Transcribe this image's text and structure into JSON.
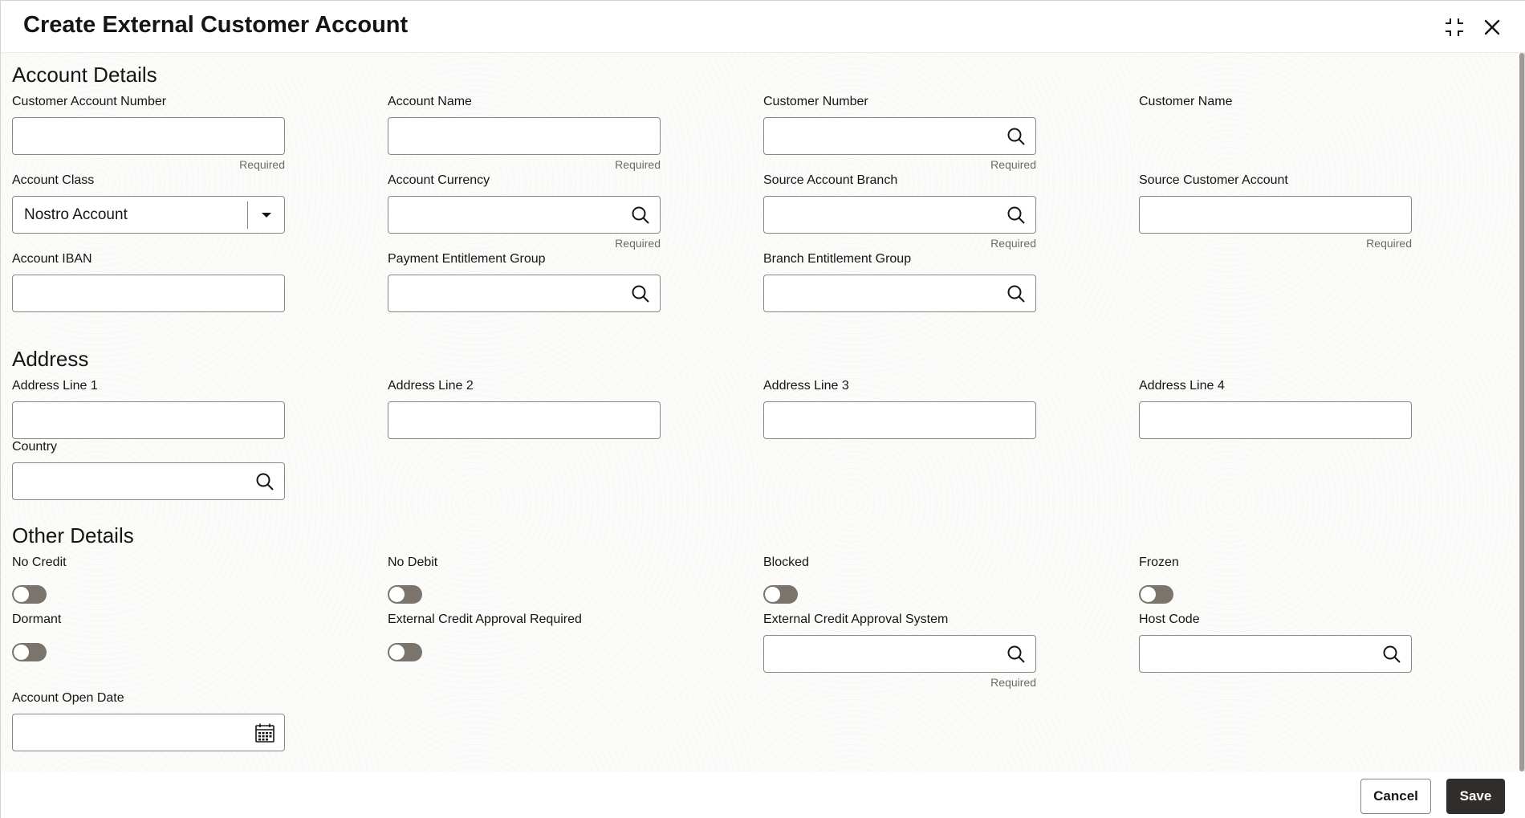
{
  "dialog": {
    "title": "Create External Customer Account",
    "icons": {
      "minimize": "compress-icon",
      "close": "close-icon"
    }
  },
  "sections": {
    "account_details": {
      "title": "Account Details",
      "customer_account_number": {
        "label": "Customer Account Number",
        "value": "",
        "hint": "Required"
      },
      "account_name": {
        "label": "Account Name",
        "value": "",
        "hint": "Required"
      },
      "customer_number": {
        "label": "Customer Number",
        "value": "",
        "hint": "Required"
      },
      "customer_name": {
        "label": "Customer Name"
      },
      "account_class": {
        "label": "Account Class",
        "value": "Nostro Account"
      },
      "account_currency": {
        "label": "Account Currency",
        "value": "",
        "hint": "Required"
      },
      "source_account_branch": {
        "label": "Source Account Branch",
        "value": "",
        "hint": "Required"
      },
      "source_customer_account": {
        "label": "Source Customer Account",
        "value": "",
        "hint": "Required"
      },
      "account_iban": {
        "label": "Account IBAN",
        "value": ""
      },
      "payment_entitlement_group": {
        "label": "Payment Entitlement Group",
        "value": ""
      },
      "branch_entitlement_group": {
        "label": "Branch Entitlement Group",
        "value": ""
      }
    },
    "address": {
      "title": "Address",
      "line1": {
        "label": "Address Line 1",
        "value": ""
      },
      "line2": {
        "label": "Address Line 2",
        "value": ""
      },
      "line3": {
        "label": "Address Line 3",
        "value": ""
      },
      "line4": {
        "label": "Address Line 4",
        "value": ""
      },
      "country": {
        "label": "Country",
        "value": ""
      }
    },
    "other_details": {
      "title": "Other Details",
      "no_credit": {
        "label": "No Credit",
        "on": false
      },
      "no_debit": {
        "label": "No Debit",
        "on": false
      },
      "blocked": {
        "label": "Blocked",
        "on": false
      },
      "frozen": {
        "label": "Frozen",
        "on": false
      },
      "dormant": {
        "label": "Dormant",
        "on": false
      },
      "ext_credit_approval_required": {
        "label": "External Credit Approval Required",
        "on": false
      },
      "ext_credit_approval_system": {
        "label": "External Credit Approval System",
        "value": "",
        "hint": "Required"
      },
      "host_code": {
        "label": "Host Code",
        "value": ""
      },
      "account_open_date": {
        "label": "Account Open Date",
        "value": ""
      }
    }
  },
  "footer": {
    "cancel_label": "Cancel",
    "save_label": "Save"
  },
  "colors": {
    "primary_button": "#312d2a",
    "toggle_off": "#7a746d",
    "field_border": "#8b8680"
  }
}
